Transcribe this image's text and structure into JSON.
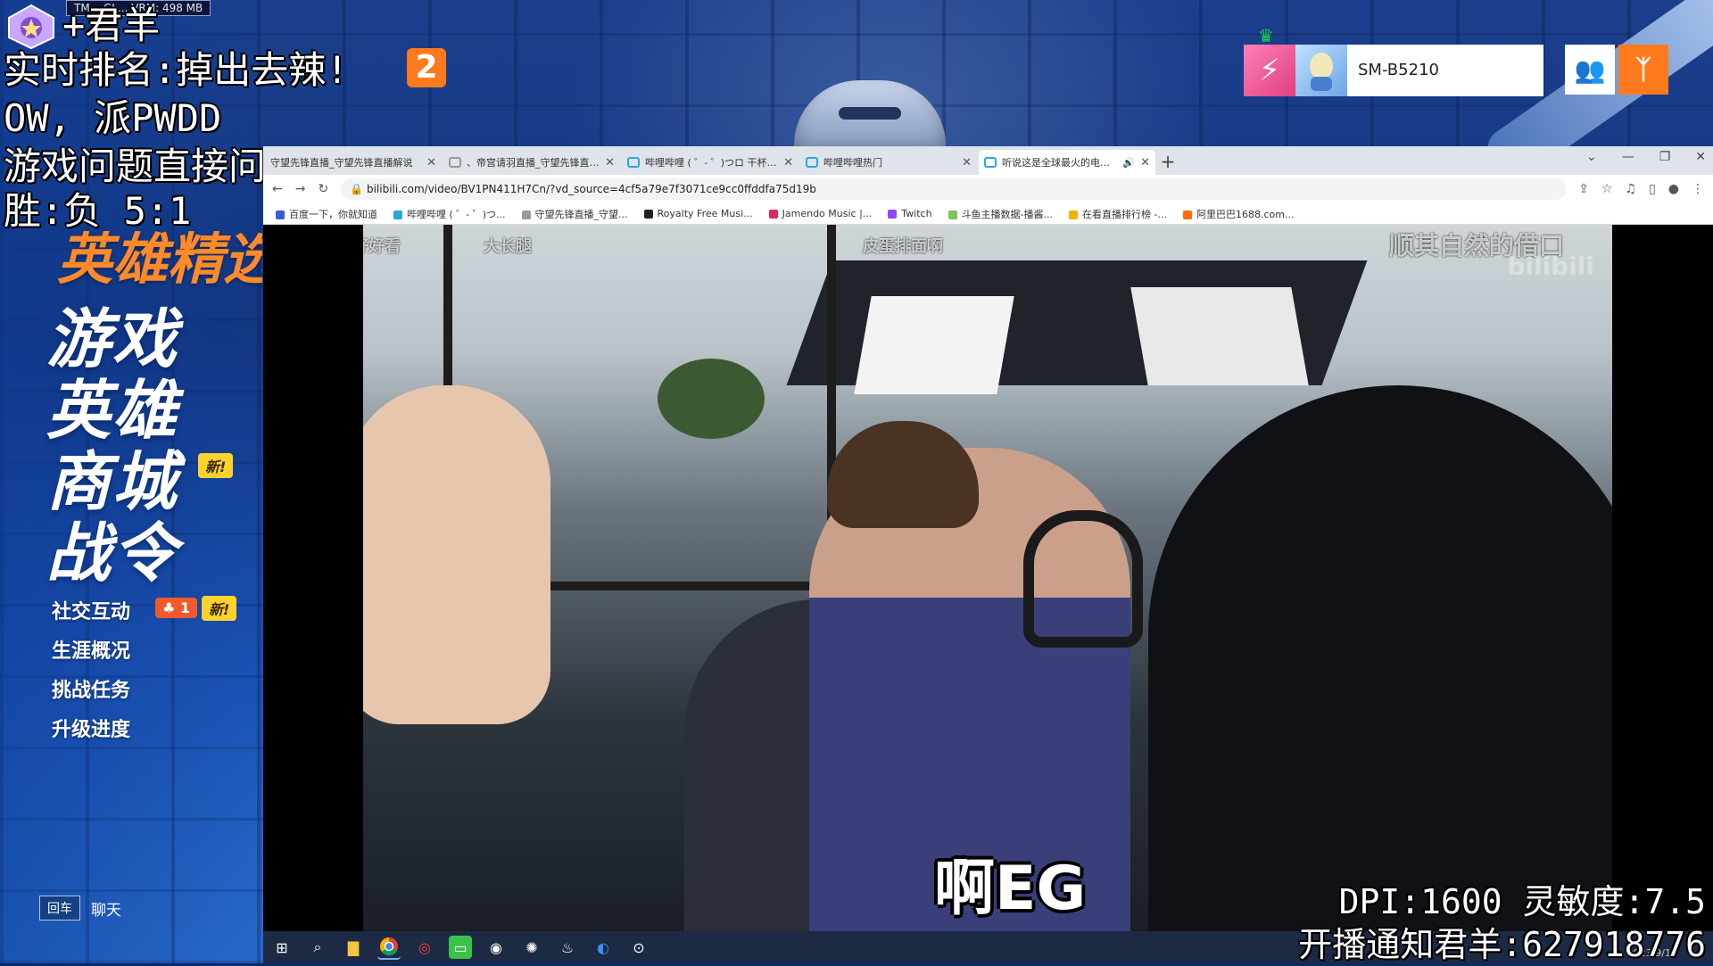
{
  "stream_overlay": {
    "perf_text": "TM... GL... VRM: 498 MB",
    "streamer_line": "+君羊",
    "line1": "实时排名:掉出去辣!",
    "line2": "OW, 派PWDD",
    "line3": "游戏问题直接问",
    "line4": "胜:负 5:1",
    "logo_digit": "2",
    "dpi_line": "DPI:1600 灵敏度:7.5",
    "notify_line": "开播通知君羊:627918776"
  },
  "game_menu": {
    "hero_gallery": "英雄精选",
    "items": [
      "游戏",
      "英雄",
      "商城",
      "战令"
    ],
    "shop_badge": "新!",
    "sub_items": [
      "社交互动",
      "生涯概况",
      "挑战任务",
      "升级进度"
    ],
    "social_count": "1",
    "social_badge": "新!",
    "chat_key": "回车",
    "chat_label": "聊天"
  },
  "player": {
    "name": "SM-B5210"
  },
  "browser": {
    "tabs": [
      {
        "title": "守望先锋直播_守望先锋直播解说"
      },
      {
        "title": "、帝宫请羽直播_守望先锋直播_"
      },
      {
        "title": "哔哩哔哩 ( ゜- ゜)つロ 干杯~-bili"
      },
      {
        "title": "哔哩哔哩热门"
      },
      {
        "title": "听说这是全球最火的电竞比赛"
      }
    ],
    "new_tab": "+",
    "url": "bilibili.com/video/BV1PN411H7Cn/?vd_source=4cf5a79e7f3071ce9cc0ffddfa75d19b",
    "bookmarks": [
      "百度一下，你就知道",
      "哔哩哔哩 ( ゜- ゜)つ...",
      "守望先锋直播_守望...",
      "Royalty Free Musi...",
      "Jamendo Music |...",
      "Twitch",
      "斗鱼主播数据-播酱...",
      "在看直播排行榜 -...",
      "阿里巴巴1688.com..."
    ]
  },
  "video": {
    "danmaku": [
      "腿好好看",
      "大长腿",
      "皮蛋排面啊",
      "顺其自然的借口"
    ],
    "subtitle": "啊EG",
    "watermark": "bilibili"
  },
  "taskbar": {
    "date": "2023/9/19"
  },
  "colors": {
    "accent_orange": "#ff7a1c",
    "badge_yellow": "#ffd22e",
    "menu_blue": "#1b54b8"
  }
}
